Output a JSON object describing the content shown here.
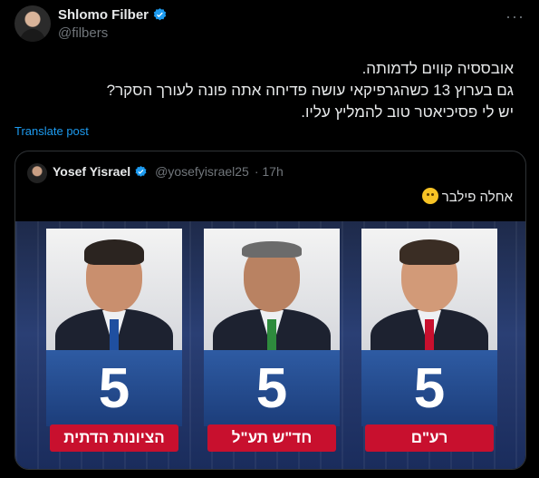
{
  "tweet": {
    "author_name": "Shlomo Filber",
    "handle": "@filbers",
    "more_label": "···",
    "lines": [
      "אובססיה קווים לדמותה.",
      "גם בערוץ 13 כשהגרפיקאי עושה פדיחה אתה פונה לעורך הסקר?",
      "יש לי פסיכיאטר טוב להמליץ עליו."
    ],
    "translate_label": "Translate post"
  },
  "quote": {
    "author_name": "Yosef Yisrael",
    "handle": "@yosefyisrael25",
    "time": "· 17h",
    "text": "אחלה פילבר",
    "emoji_icon": "smiling-face-hearts-icon"
  },
  "graphic": {
    "panels": [
      {
        "number": "5",
        "label": "הציונות הדתית",
        "tie_color": "#1f4fa0"
      },
      {
        "number": "5",
        "label": "חד\"ש תע\"ל",
        "tie_color": "#2e8b3d"
      },
      {
        "number": "5",
        "label": "רע\"ם",
        "tie_color": "#c8102e"
      }
    ]
  },
  "colors": {
    "accent": "#1d9bf0",
    "label_red": "#c8102e",
    "number_blue": "#2e5ba3"
  }
}
